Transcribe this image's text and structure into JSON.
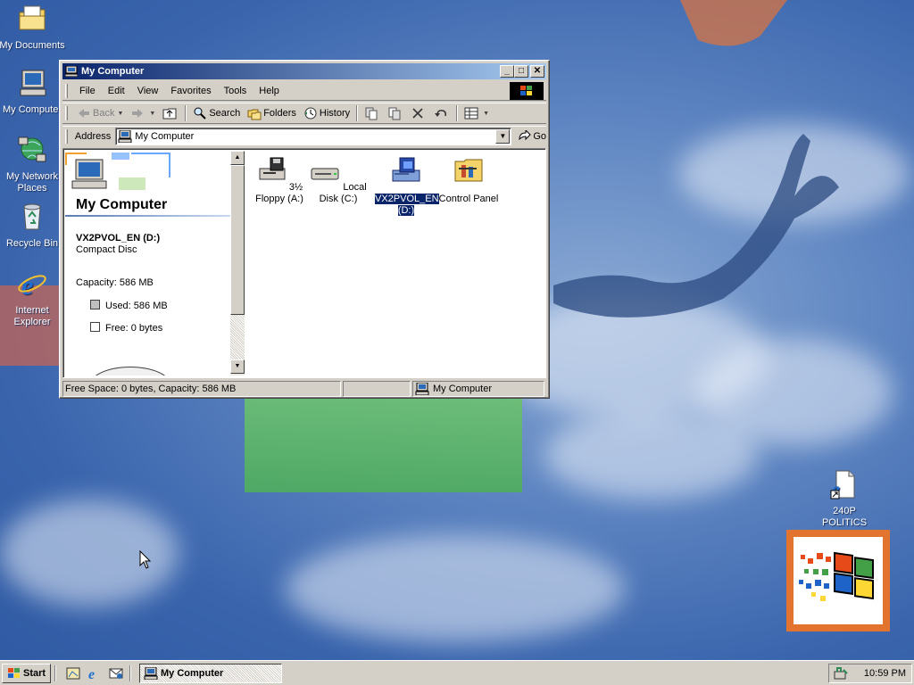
{
  "desktop": {
    "icons": [
      {
        "label": "My Documents",
        "icon": "my-documents-icon"
      },
      {
        "label": "My Computer",
        "icon": "my-computer-icon"
      },
      {
        "label": "My Network Places",
        "icon": "network-places-icon"
      },
      {
        "label": "Recycle Bin",
        "icon": "recycle-bin-icon"
      },
      {
        "label": "Internet Explorer",
        "icon": "internet-explorer-icon"
      },
      {
        "label": "240P POLITICS",
        "icon": "internet-shortcut-icon"
      }
    ]
  },
  "window": {
    "title": "My Computer",
    "menu": [
      "File",
      "Edit",
      "View",
      "Favorites",
      "Tools",
      "Help"
    ],
    "toolbar": {
      "back": "Back",
      "search": "Search",
      "folders": "Folders",
      "history": "History"
    },
    "address": {
      "label": "Address",
      "value": "My Computer",
      "go": "Go"
    },
    "left_pane": {
      "title": "My Computer",
      "item_name": "VX2PVOL_EN (D:)",
      "item_type": "Compact Disc",
      "capacity": "Capacity: 586 MB",
      "used": "Used: 586 MB",
      "free": "Free: 0 bytes"
    },
    "files": [
      {
        "label": "3½ Floppy (A:)",
        "icon": "floppy-drive-icon",
        "selected": false
      },
      {
        "label": "Local Disk (C:)",
        "icon": "hard-disk-icon",
        "selected": false
      },
      {
        "label": "VX2PVOL_EN (D:)",
        "icon": "cd-drive-icon",
        "selected": true
      },
      {
        "label": "Control Panel",
        "icon": "control-panel-icon",
        "selected": false
      }
    ],
    "status": {
      "info": "Free Space: 0 bytes, Capacity: 586 MB",
      "zone": "My Computer"
    }
  },
  "taskbar": {
    "start": "Start",
    "task": "My Computer",
    "clock": "10:59 PM"
  }
}
